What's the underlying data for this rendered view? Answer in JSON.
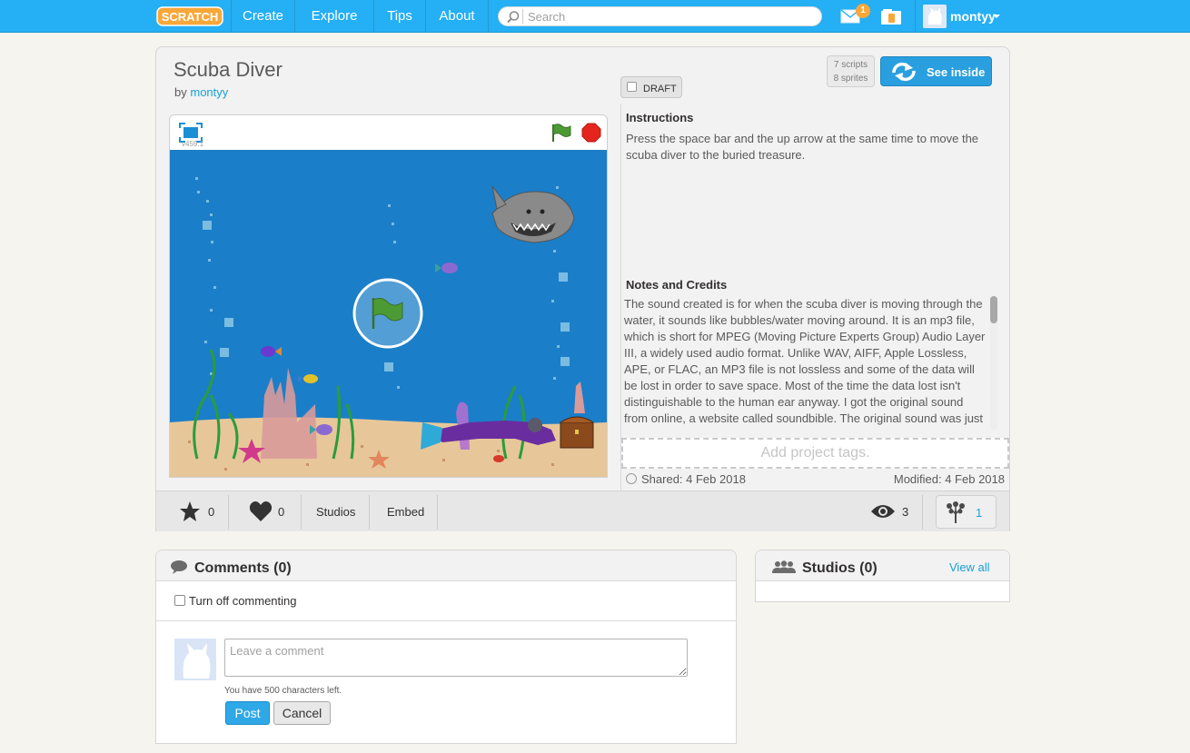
{
  "nav": {
    "logo_text": "SCRATCH",
    "links": [
      "Create",
      "Explore",
      "Tips",
      "About"
    ],
    "search_placeholder": "Search",
    "messages_count": "1",
    "username": "montyy"
  },
  "project": {
    "title": "Scuba Diver",
    "by_prefix": "by",
    "author": "montyy",
    "draft_label": "DRAFT",
    "scripts_count": "7 scripts",
    "sprites_count": "8 sprites",
    "see_inside_label": "See inside",
    "player_version": "v459.1",
    "instructions_heading": "Instructions",
    "instructions": "Press the space bar and the up arrow at the same time to move the scuba diver to the buried treasure.",
    "notes_heading": "Notes and Credits",
    "notes": "The sound created is for when the scuba diver is moving through the water, it sounds like bubbles/water moving around. It is an mp3 file, which is short for MPEG (Moving Picture Experts Group) Audio Layer III, a widely used audio format. Unlike WAV, AIFF, Apple Lossless, APE, or FLAC, an MP3 file is not lossless and some of the data will be lost in order to save space. Most of the time the data lost isn't distinguishable to the human ear anyway. I got the original sound from online, a website called soundbible. The original sound was just",
    "tags_placeholder": "Add project tags.",
    "shared": "Shared: 4 Feb 2018",
    "modified": "Modified: 4 Feb 2018"
  },
  "stats": {
    "favorites": "0",
    "loves": "0",
    "studios_label": "Studios",
    "embed_label": "Embed",
    "views": "3",
    "remixes": "1"
  },
  "comments": {
    "title": "Comments (0)",
    "turn_off_label": "Turn off commenting",
    "placeholder": "Leave a comment",
    "chars_left": "You have 500 characters left.",
    "post_label": "Post",
    "cancel_label": "Cancel"
  },
  "studios": {
    "title": "Studios (0)",
    "view_all": "View all"
  },
  "colors": {
    "nav_blue": "#25aff4",
    "link_blue": "#1aa0d8",
    "stage_water": "#1b7ec8",
    "sand": "#e7c79a"
  }
}
